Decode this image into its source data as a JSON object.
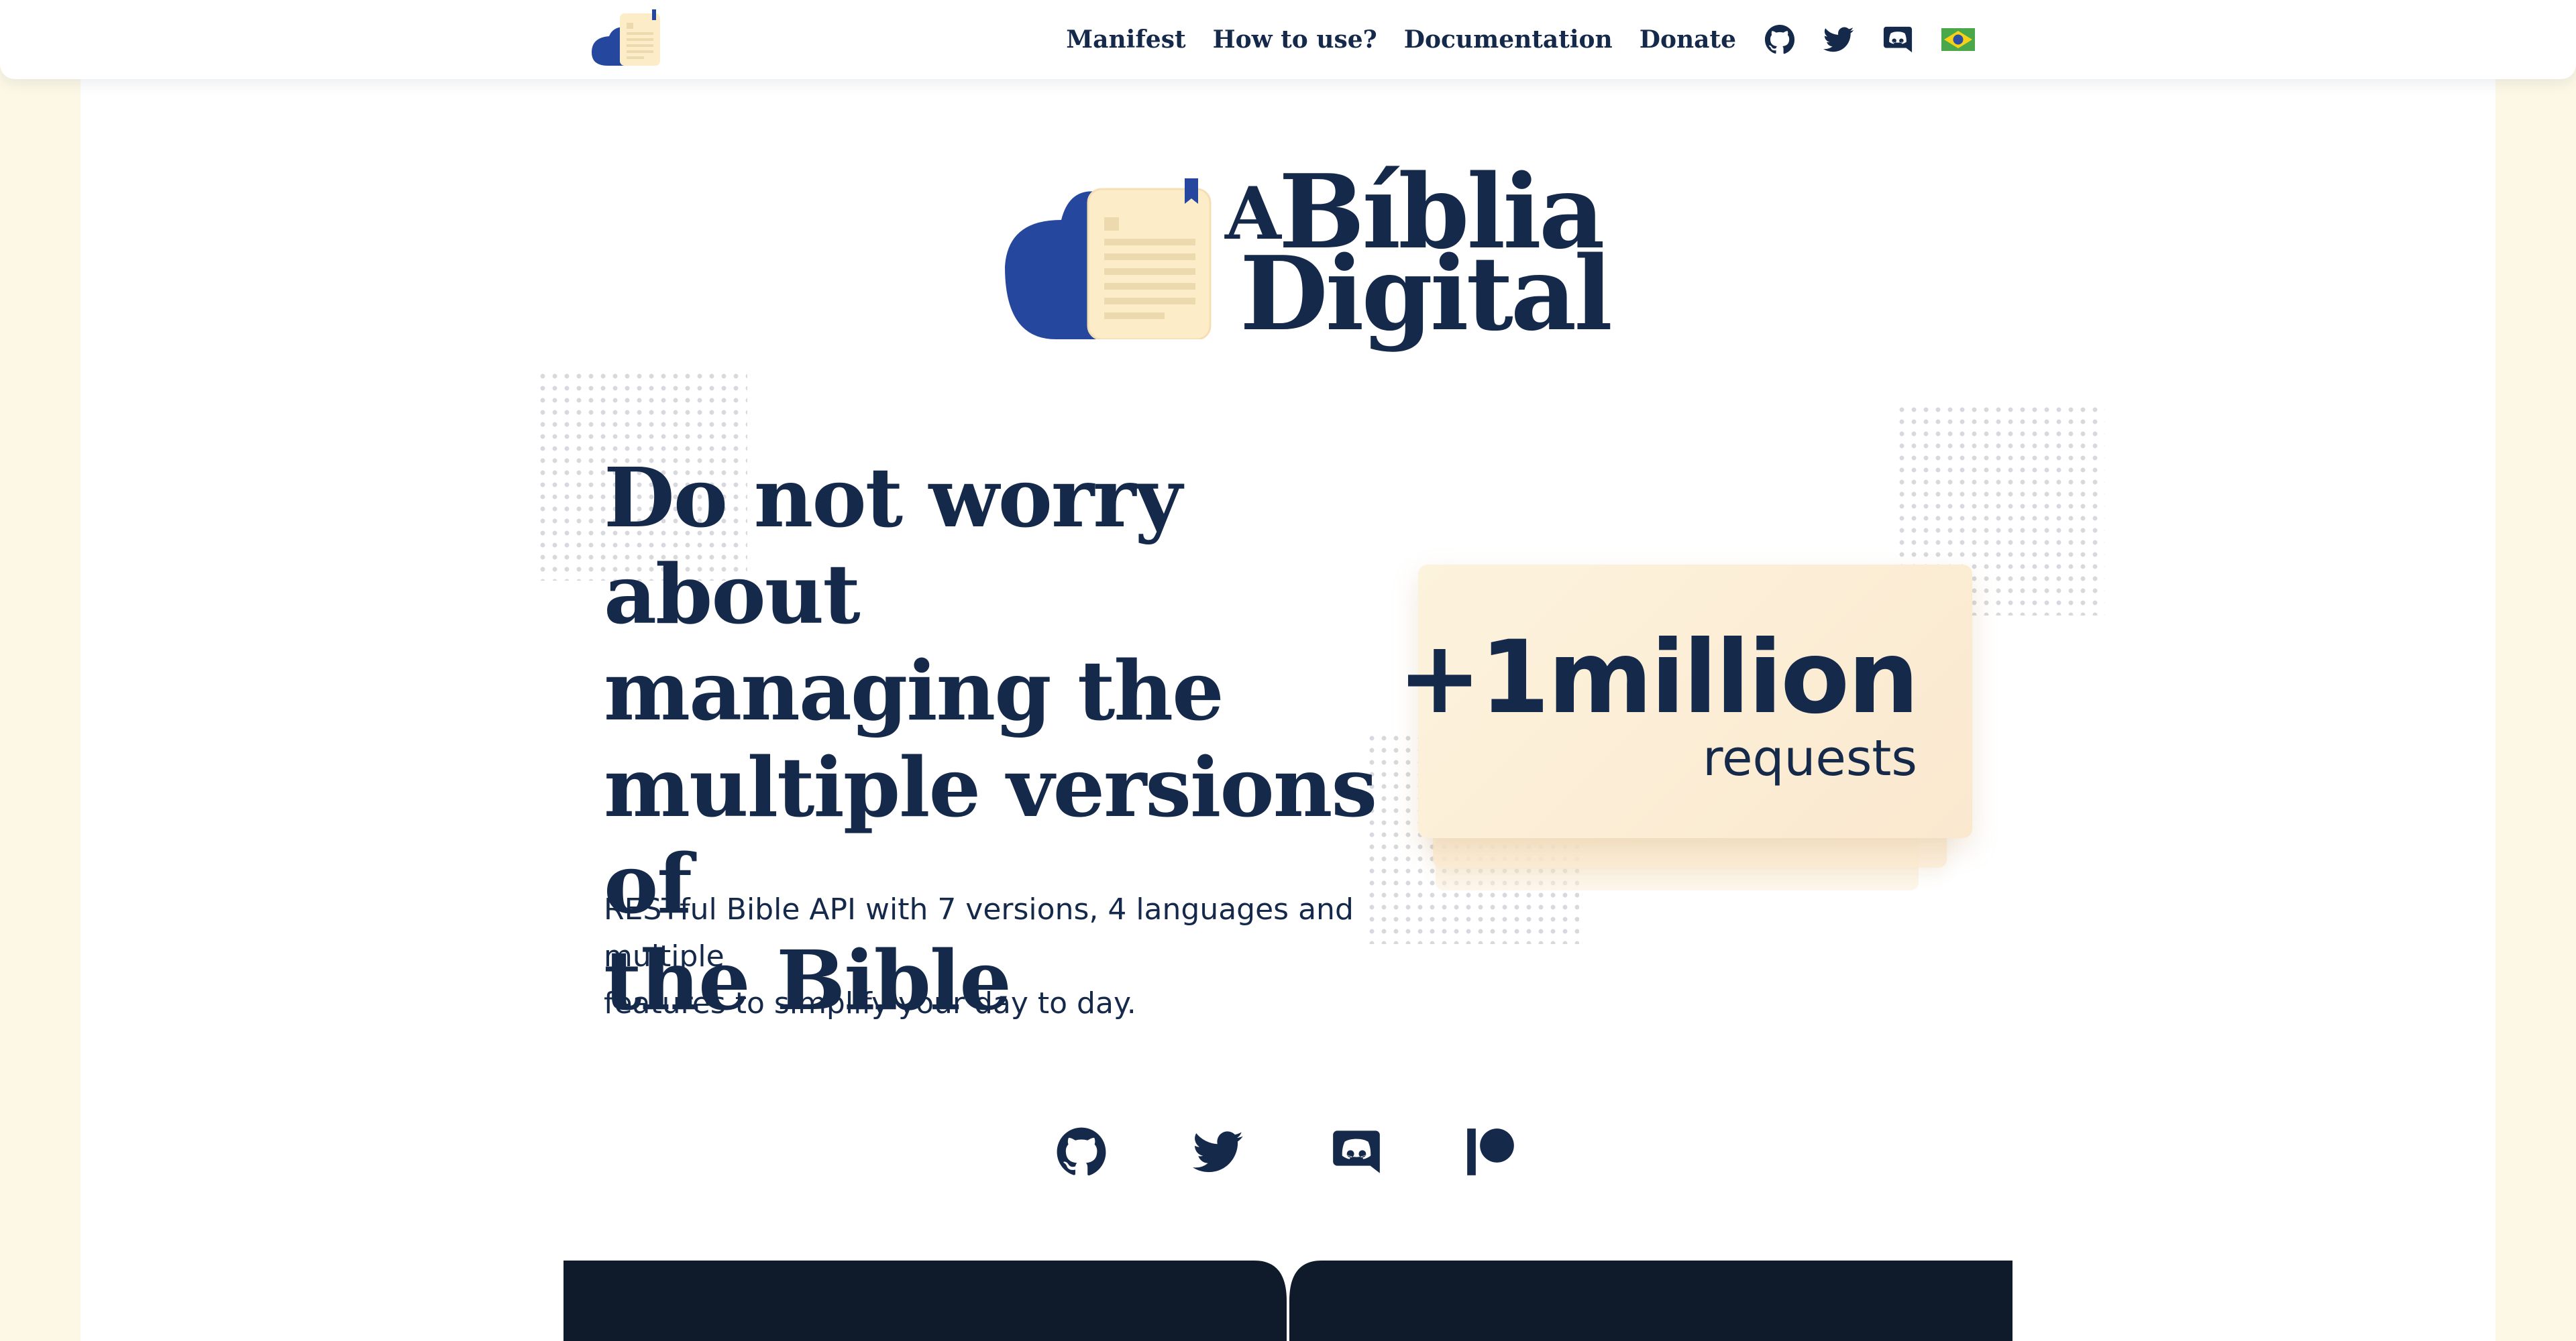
{
  "nav": {
    "links": [
      "Manifest",
      "How to use?",
      "Documentation",
      "Donate"
    ],
    "icons": [
      "github-icon",
      "twitter-icon",
      "discord-icon",
      "brazil-flag-icon"
    ]
  },
  "logo": {
    "article": "A",
    "line1": "Bíblia",
    "line2": "Digital"
  },
  "hero": {
    "headline_lines": [
      "Do not worry about",
      "managing the",
      "multiple versions of",
      "the Bible"
    ],
    "subtitle_lines": [
      "RESTful Bible API with 7 versions, 4 languages and multiple",
      "features to simplify your day to day."
    ]
  },
  "stats": {
    "number": "+1million",
    "label": "requests"
  },
  "social": {
    "icons": [
      "github-icon",
      "twitter-icon",
      "discord-icon",
      "patreon-icon"
    ]
  },
  "colors": {
    "navy": "#15294a",
    "accent_blue": "#26479e",
    "paper": "#fbe8cf",
    "page_bg": "#fdf8e6",
    "dark_section": "#0f1b2b",
    "flag_green": "#4aa84a",
    "flag_yellow": "#f7d117"
  }
}
